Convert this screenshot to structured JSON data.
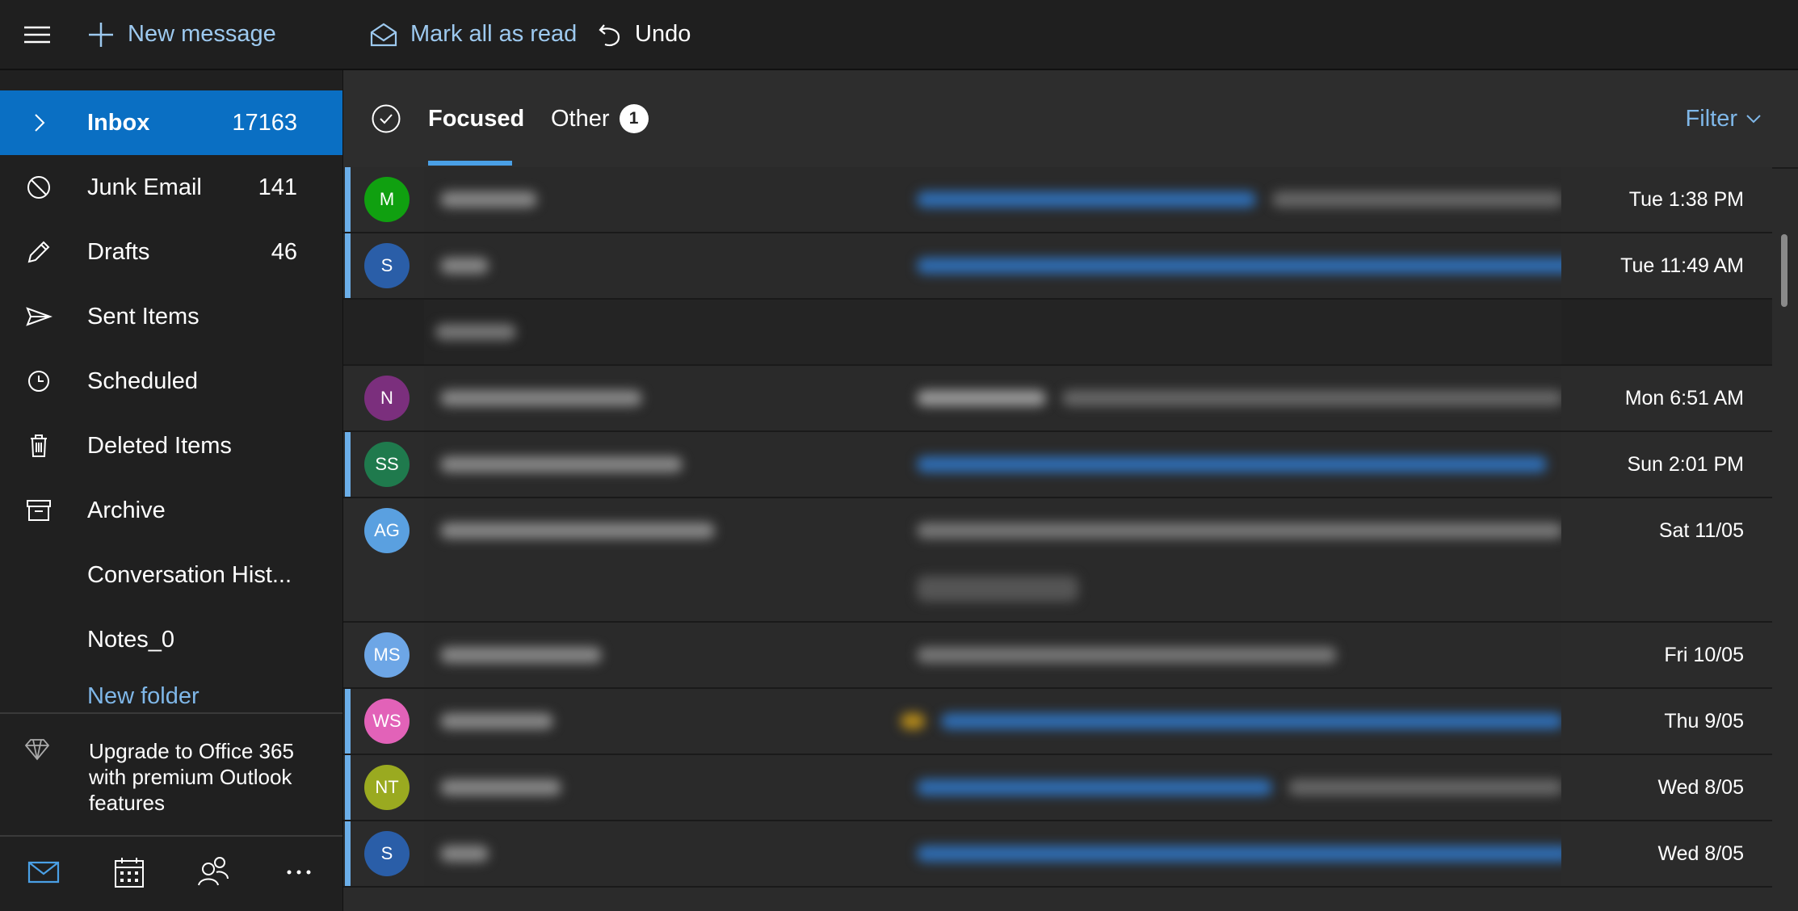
{
  "toolbar": {
    "new_message": "New message",
    "mark_all_read": "Mark all as read",
    "undo": "Undo"
  },
  "sidebar": {
    "items": [
      {
        "label": "Inbox",
        "count": "17163",
        "icon": "chevron-right-icon"
      },
      {
        "label": "Junk Email",
        "count": "141",
        "icon": "block-icon"
      },
      {
        "label": "Drafts",
        "count": "46",
        "icon": "pencil-icon"
      },
      {
        "label": "Sent Items",
        "count": "",
        "icon": "send-icon"
      },
      {
        "label": "Scheduled",
        "count": "",
        "icon": "clock-icon"
      },
      {
        "label": "Deleted Items",
        "count": "",
        "icon": "trash-icon"
      },
      {
        "label": "Archive",
        "count": "",
        "icon": "archive-icon"
      },
      {
        "label": "Conversation Hist...",
        "count": ""
      },
      {
        "label": "Notes_0",
        "count": ""
      }
    ],
    "new_folder": "New folder",
    "upgrade": "Upgrade to Office 365 with premium Outlook features",
    "bottom_nav": [
      "mail-icon",
      "calendar-icon",
      "people-icon",
      "more-icon"
    ]
  },
  "tabs": {
    "focused": "Focused",
    "other": "Other",
    "other_badge": "1",
    "filter": "Filter"
  },
  "messages": [
    {
      "initials": "M",
      "color": "#10a010",
      "date": "Tue 1:38 PM",
      "unread": true
    },
    {
      "initials": "S",
      "color": "#2a5ea8",
      "date": "Tue 11:49 AM",
      "unread": true
    },
    {
      "initials": "N",
      "color": "#7b2f7d",
      "date": "Mon 6:51 AM",
      "unread": false
    },
    {
      "initials": "SS",
      "color": "#1f7a4d",
      "date": "Sun 2:01 PM",
      "unread": true
    },
    {
      "initials": "AG",
      "color": "#5aa0e0",
      "date": "Sat 11/05",
      "unread": false
    },
    {
      "initials": "MS",
      "color": "#6da6e6",
      "date": "Fri 10/05",
      "unread": false
    },
    {
      "initials": "WS",
      "color": "#e262b8",
      "date": "Thu 9/05",
      "unread": true
    },
    {
      "initials": "NT",
      "color": "#9aaa20",
      "date": "Wed 8/05",
      "unread": true
    },
    {
      "initials": "S",
      "color": "#2a5ea8",
      "date": "Wed 8/05",
      "unread": true
    }
  ],
  "colors": {
    "accent": "#0a6fc3",
    "link": "#7fb7e8",
    "unread_bar": "#6baee8"
  }
}
